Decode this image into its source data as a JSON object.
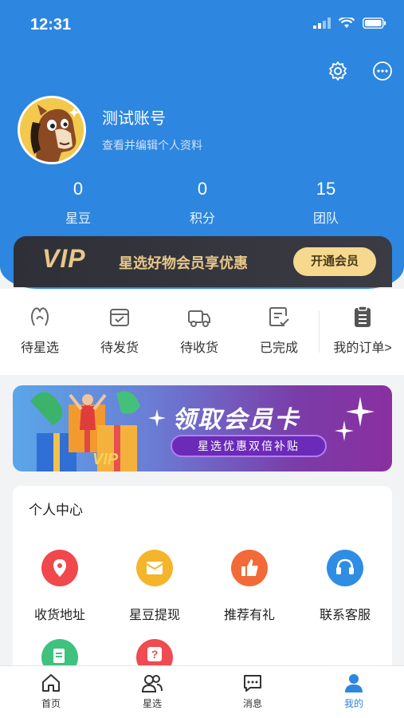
{
  "status_bar": {
    "time": "12:31"
  },
  "profile": {
    "username": "测试账号",
    "subtitle": "查看并编辑个人资料",
    "stats": [
      {
        "value": "0",
        "label": "星豆"
      },
      {
        "value": "0",
        "label": "积分"
      },
      {
        "value": "15",
        "label": "团队"
      }
    ]
  },
  "vip": {
    "logo": "VIP",
    "text": "星选好物会员享优惠",
    "button": "开通会员"
  },
  "orders": [
    {
      "label": "待星选",
      "icon": "star-select-icon"
    },
    {
      "label": "待发货",
      "icon": "box-icon"
    },
    {
      "label": "待收货",
      "icon": "truck-icon"
    },
    {
      "label": "已完成",
      "icon": "checklist-icon"
    },
    {
      "label": "我的订单>",
      "icon": "clipboard-icon"
    }
  ],
  "banner": {
    "title": "领取会员卡",
    "subtitle": "星选优惠双倍补贴",
    "vip_mark": "VIP"
  },
  "personal_center": {
    "title": "个人中心",
    "items": [
      {
        "label": "收货地址",
        "icon": "location-icon",
        "color": "#f0484c"
      },
      {
        "label": "星豆提现",
        "icon": "wallet-icon",
        "color": "#f5b52a"
      },
      {
        "label": "推荐有礼",
        "icon": "thumbs-up-icon",
        "color": "#f26a38"
      },
      {
        "label": "联系客服",
        "icon": "headset-icon",
        "color": "#2f8de4"
      }
    ],
    "partial_items": [
      {
        "icon": "document-icon",
        "color": "#3fc27e"
      },
      {
        "icon": "help-icon",
        "color": "#ef4b52",
        "glyph": "?"
      }
    ]
  },
  "tabbar": [
    {
      "label": "首页",
      "icon": "home-icon",
      "active": false
    },
    {
      "label": "星选",
      "icon": "users-icon",
      "active": false
    },
    {
      "label": "消息",
      "icon": "message-icon",
      "active": false
    },
    {
      "label": "我的",
      "icon": "profile-icon",
      "active": true
    }
  ],
  "colors": {
    "primary": "#2d86df",
    "vip_gold": "#e8c78a",
    "page_bg": "#f2f3f5"
  }
}
